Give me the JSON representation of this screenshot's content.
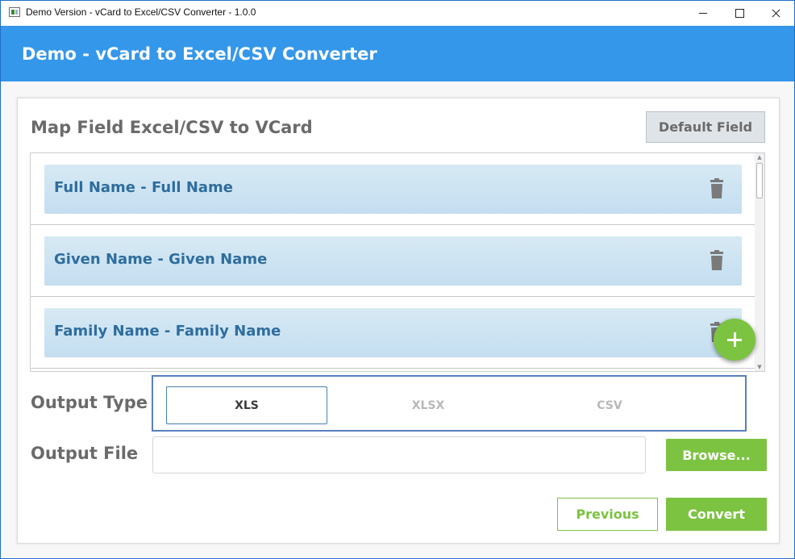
{
  "window": {
    "title": "Demo Version - vCard to Excel/CSV Converter - 1.0.0"
  },
  "header": {
    "title": "Demo - vCard to Excel/CSV Converter"
  },
  "map_section": {
    "title": "Map Field Excel/CSV to VCard",
    "default_button": "Default Field",
    "items": [
      {
        "label": "Full Name - Full Name"
      },
      {
        "label": "Given Name - Given Name"
      },
      {
        "label": "Family Name - Family Name"
      }
    ]
  },
  "output_type": {
    "label": "Output Type",
    "options": [
      "XLS",
      "XLSX",
      "CSV"
    ],
    "selected": "XLS"
  },
  "output_file": {
    "label": "Output File",
    "value": "",
    "browse_button": "Browse..."
  },
  "footer": {
    "previous_button": "Previous",
    "convert_button": "Convert"
  },
  "colors": {
    "header_blue": "#3497ea",
    "accent_green": "#7cc342",
    "item_text_blue": "#2e6d9e",
    "selection_border": "#5a7fc0"
  },
  "icons": {
    "window_app": "app-icon",
    "minimize": "minimize-icon",
    "maximize": "maximize-icon",
    "close": "close-icon",
    "delete": "trash-icon",
    "add": "plus-icon"
  }
}
